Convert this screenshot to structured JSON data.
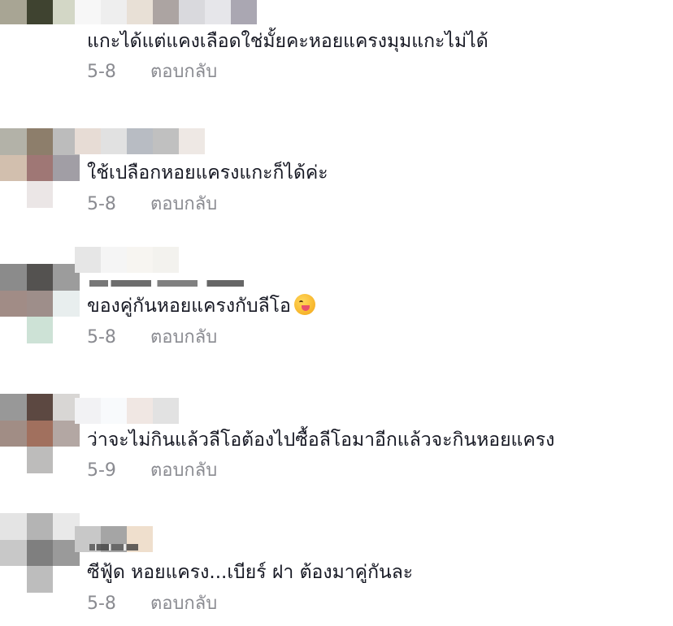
{
  "comments": [
    {
      "text": "แกะได้แต่แคงเลือดใช่มั้ยคะหอยแครงมุมแกะไม่ได้",
      "date": "5-8",
      "reply_label": "ตอบกลับ",
      "avatar_colors": [
        "#9c9c8e",
        "#5b5643",
        "#d7d5cd",
        "#a8a594",
        "#3f4330",
        "#d3d7c6",
        "#ffffff",
        "#ffffff",
        "#ffffff"
      ],
      "username_colors": [
        "#f7f7f7",
        "#eeeeee",
        "#e8e0d6",
        "#aca4a2",
        "#d9d9dd",
        "#e6e6ea",
        "#aaa7b2"
      ]
    },
    {
      "text": "ใช้เปลือกหอยแครงแกะก็ได้ค่ะ",
      "date": "5-8",
      "reply_label": "ตอบกลับ",
      "avatar_colors": [
        "#b3b2a8",
        "#8d7e6b",
        "#bcbcbc",
        "#d2bfae",
        "#9f7775",
        "#a19ea5",
        "#ffffff",
        "#ebe6e6",
        "#ffffff"
      ],
      "username_colors": [
        "#e7dcd5",
        "#e1e1e1",
        "#b8bcc3",
        "#c0c0c0",
        "#eee8e4"
      ]
    },
    {
      "text": "ของคู่กันหอยแครงกับลีโอ",
      "date": "5-8",
      "reply_label": "ตอบกลับ",
      "avatar_colors": [
        "#8b8b8b",
        "#545250",
        "#9c9c9c",
        "#a18c86",
        "#9e8e8a",
        "#e8eeee",
        "#ffffff",
        "#cde2d6",
        "#ffffff"
      ],
      "username_colors": [
        "#e6e6e6",
        "#f5f5f5",
        "#f7f5f1",
        "#f3f2ee"
      ]
    },
    {
      "text": "ว่าจะไม่กินแล้วลีโอต้องไปซื้อลีโอมาอีกแล้วจะกินหอยแครง",
      "date": "5-9",
      "reply_label": "ตอบกลับ",
      "avatar_colors": [
        "#989898",
        "#5c4841",
        "#d8d6d4",
        "#a18d85",
        "#a1705e",
        "#b3a7a3",
        "#ffffff",
        "#bdbcbb",
        "#ffffff"
      ],
      "username_colors": [
        "#f2f2f4",
        "#f8fafc",
        "#f0e7e3",
        "#e2e2e2"
      ]
    },
    {
      "text": "ซีฟู้ด หอยแครง...เบียร์ ฝา ต้องมาคู่กันละ",
      "date": "5-8",
      "reply_label": "ตอบกลับ",
      "avatar_colors": [
        "#e4e4e4",
        "#b4b4b4",
        "#e9e9e9",
        "#c8c8c8",
        "#7f7f7f",
        "#9a9a9a",
        "#ffffff",
        "#bdbdbd",
        "#ffffff"
      ],
      "username_colors": [
        "#c8c8c8",
        "#a5a5a5",
        "#efdfcd"
      ]
    }
  ]
}
